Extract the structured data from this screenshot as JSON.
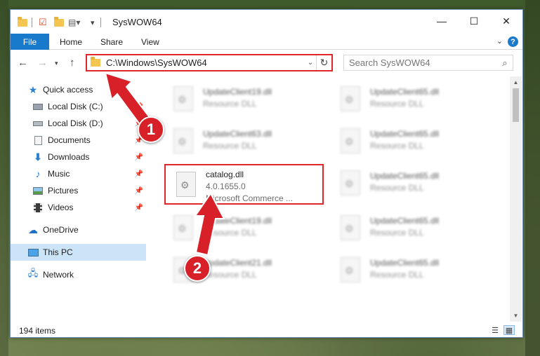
{
  "window": {
    "title": "SysWOW64",
    "controls": {
      "minimize": "—",
      "maximize": "☐",
      "close": "✕"
    }
  },
  "ribbon": {
    "tabs": [
      "File",
      "Home",
      "Share",
      "View"
    ],
    "help": "?"
  },
  "navigation": {
    "address": "C:\\Windows\\SysWOW64",
    "search_placeholder": "Search SysWOW64"
  },
  "sidebar": {
    "items": [
      {
        "label": "Quick access",
        "icon": "star-icon"
      },
      {
        "label": "Local Disk (C:)",
        "icon": "drive-icon"
      },
      {
        "label": "Local Disk (D:)",
        "icon": "drive-icon"
      },
      {
        "label": "Documents",
        "icon": "documents-icon"
      },
      {
        "label": "Downloads",
        "icon": "downloads-icon"
      },
      {
        "label": "Music",
        "icon": "music-icon"
      },
      {
        "label": "Pictures",
        "icon": "pictures-icon"
      },
      {
        "label": "Videos",
        "icon": "videos-icon"
      },
      {
        "label": "OneDrive",
        "icon": "cloud-icon"
      },
      {
        "label": "This PC",
        "icon": "computer-icon"
      },
      {
        "label": "Network",
        "icon": "network-icon"
      }
    ]
  },
  "files": [
    {
      "name": "UpdateClient19.dll",
      "type": "Resource DLL"
    },
    {
      "name": "UpdateClient65.dll",
      "type": "Resource DLL"
    },
    {
      "name": "UpdateClient63.dll",
      "type": "Resource DLL"
    },
    {
      "name": "UpdateClient65.dll",
      "type": "Resource DLL"
    },
    {
      "name": "catalog.dll",
      "version": "4.0.1655.0",
      "type": "Microsoft Commerce ..."
    },
    {
      "name": "UpdateClient65.dll",
      "type": "Resource DLL"
    },
    {
      "name": "UpdateClient19.dll",
      "type": "Resource DLL"
    },
    {
      "name": "UpdateClient65.dll",
      "type": "Resource DLL"
    },
    {
      "name": "UpdateClient21.dll",
      "type": "Resource DLL"
    },
    {
      "name": "UpdateClient65.dll",
      "type": "Resource DLL"
    }
  ],
  "status": {
    "item_count": "194 items"
  },
  "annotations": {
    "step1": "1",
    "step2": "2"
  },
  "colors": {
    "accent": "#1979ca",
    "highlight": "#e0262b",
    "selected": "#cce4f7"
  }
}
